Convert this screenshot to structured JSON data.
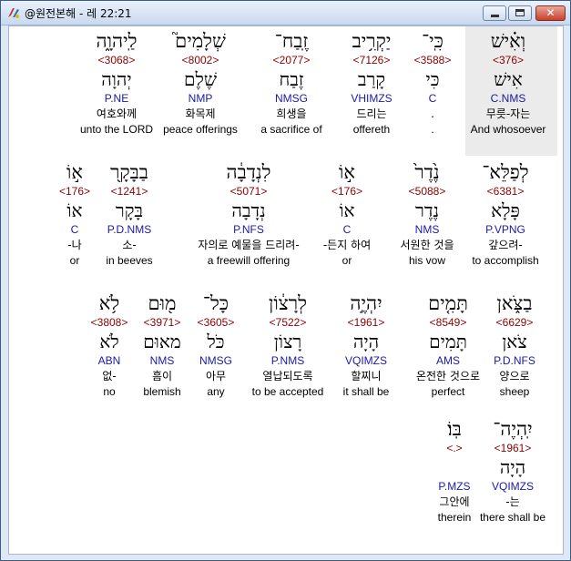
{
  "window": {
    "title": "@원전본해 - 레 22:21",
    "close_glyph": "✕"
  },
  "colors": {
    "strong": "#8b0000",
    "morph": "#1a1aa6",
    "selected_bg": "#ebebeb"
  },
  "rows": [
    [
      {
        "heb": "לַֽיהוָ֑ה",
        "strong": "<3068>",
        "lemma": "יְהוָה",
        "morph": "P.NE",
        "kor": "여호와께",
        "eng": "unto the LORD"
      },
      {
        "heb": "שְׁלָמִים֮",
        "strong": "<8002>",
        "lemma": "שֶׁלֶם",
        "morph": "NMP",
        "kor": "화목제",
        "eng": "peace offerings"
      },
      {
        "heb": "זֶֽבַח־",
        "strong": "<2077>",
        "lemma": "זֶבַח",
        "morph": "NMSG",
        "kor": "희생을",
        "eng": "a sacrifice of"
      },
      {
        "heb": "יַקְרִ֥יב",
        "strong": "<7126>",
        "lemma": "קָרַב",
        "morph": "VHIMZS",
        "kor": "드리는",
        "eng": "offereth"
      },
      {
        "heb": "כִּֽי־",
        "strong": "<3588>",
        "lemma": "כִּי",
        "morph": "C",
        "kor": ".",
        "eng": "."
      },
      {
        "heb": "וְאִ֗ישׁ",
        "strong": "<376>",
        "lemma": "אִישׁ",
        "morph": "C.NMS",
        "kor": "무릇-자는",
        "eng": "And whosoever",
        "selected": true
      }
    ],
    [
      {
        "heb": "א֣וֹ",
        "strong": "<176>",
        "lemma": "אוֹ",
        "morph": "C",
        "kor": "-나",
        "eng": "or"
      },
      {
        "heb": "בַבָּקָ֖ר",
        "strong": "<1241>",
        "lemma": "בָּקָר",
        "morph": "P.D.NMS",
        "kor": "소-",
        "eng": "in beeves"
      },
      {
        "heb": "לִנְדָבָ֔ה",
        "strong": "<5071>",
        "lemma": "נְדָבָה",
        "morph": "P.NFS",
        "kor": "자의로 예물을 드리려-",
        "eng": "a freewill offering"
      },
      {
        "heb": "א֣וֹ",
        "strong": "<176>",
        "lemma": "אוֹ",
        "morph": "C",
        "kor": "-든지 하여",
        "eng": "or"
      },
      {
        "heb": "נֶ֙דֶר֙",
        "strong": "<5088>",
        "lemma": "נֶדֶר",
        "morph": "NMS",
        "kor": "서원한 것을",
        "eng": "his vow"
      },
      {
        "heb": "לְפַלֵּא־",
        "strong": "<6381>",
        "lemma": "פָּלָא",
        "morph": "P.VPNG",
        "kor": "갚으려-",
        "eng": "to accomplish"
      }
    ],
    [
      {
        "heb": "לֹ֥א",
        "strong": "<3808>",
        "lemma": "לֹא",
        "morph": "ABN",
        "kor": "없-",
        "eng": "no"
      },
      {
        "heb": "מ֖וּם",
        "strong": "<3971>",
        "lemma": "מאוּם",
        "morph": "NMS",
        "kor": "흠이",
        "eng": "blemish"
      },
      {
        "heb": "כָּל־",
        "strong": "<3605>",
        "lemma": "כֹּל",
        "morph": "NMSG",
        "kor": "아무",
        "eng": "any"
      },
      {
        "heb": "לְרָצ֔וֹן",
        "strong": "<7522>",
        "lemma": "רָצוֹן",
        "morph": "P.NMS",
        "kor": "열납되도록",
        "eng": "to be accepted"
      },
      {
        "heb": "יִהְיֶ֣ה",
        "strong": "<1961>",
        "lemma": "הָיָה",
        "morph": "VQIMZS",
        "kor": "할찌니",
        "eng": "it shall be"
      },
      {
        "heb": "תָּמִ֤ים",
        "strong": "<8549>",
        "lemma": "תָּמִים",
        "morph": "AMS",
        "kor": "온전한 것으로",
        "eng": "perfect"
      },
      {
        "heb": "בַצֹּ֑אן",
        "strong": "<6629>",
        "lemma": "צֹאן",
        "morph": "P.D.NFS",
        "kor": "양으로",
        "eng": "sheep"
      }
    ],
    [
      {
        "heb": "בּֽוֹ׃",
        "strong": "<.>",
        "lemma": "",
        "morph": "P.MZS",
        "kor": "그안에",
        "eng": "therein"
      },
      {
        "heb": "יִֽהְיֶה־",
        "strong": "<1961>",
        "lemma": "הָיָה",
        "morph": "VQIMZS",
        "kor": "-는",
        "eng": "there shall be"
      }
    ]
  ]
}
